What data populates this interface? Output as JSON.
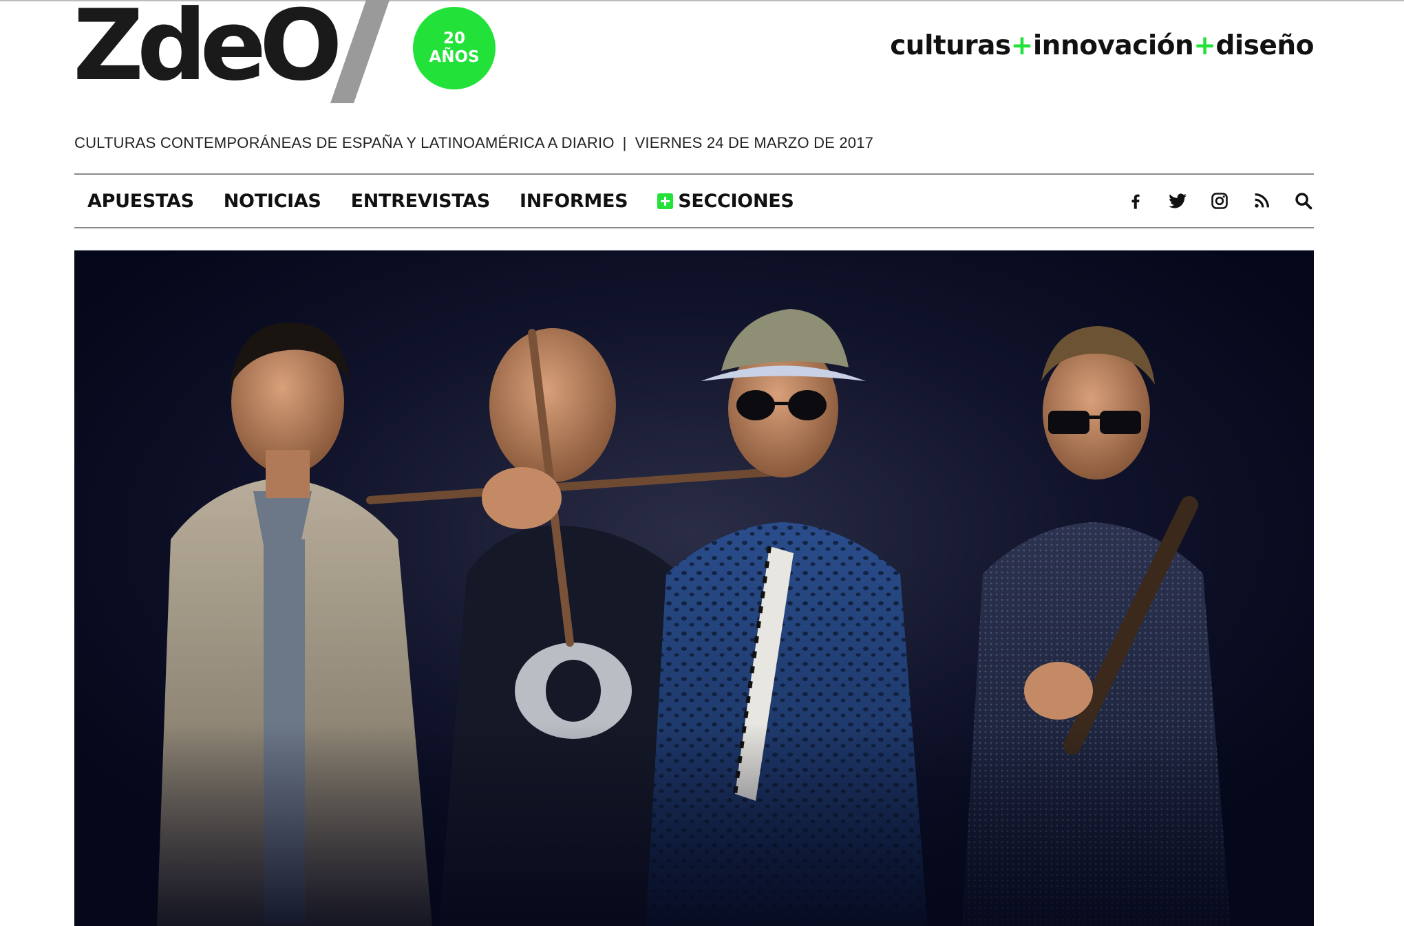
{
  "brand": {
    "logo": "ZdeO",
    "anniversary_number": "20",
    "anniversary_word": "AÑOS",
    "tagline_parts": [
      "culturas",
      "+",
      "innovación",
      "+",
      "diseño"
    ]
  },
  "subheader": {
    "description": "CULTURAS CONTEMPORÁNEAS DE ESPAÑA Y LATINOAMÉRICA A DIARIO",
    "separator": "|",
    "date": "VIERNES 24 DE MARZO DE 2017"
  },
  "nav": {
    "items": [
      {
        "label": "APUESTAS"
      },
      {
        "label": "NOTICIAS"
      },
      {
        "label": "ENTREVISTAS"
      },
      {
        "label": "INFORMES"
      },
      {
        "label": "SECCIONES"
      }
    ]
  },
  "social": [
    "facebook-icon",
    "twitter-icon",
    "instagram-icon",
    "rss-icon",
    "search-icon"
  ],
  "hero": {
    "image": "band-photo"
  },
  "colors": {
    "accent": "#22e23a",
    "text": "#111111",
    "rule": "#8a8a8a",
    "hero_bg": "#070a1e"
  }
}
